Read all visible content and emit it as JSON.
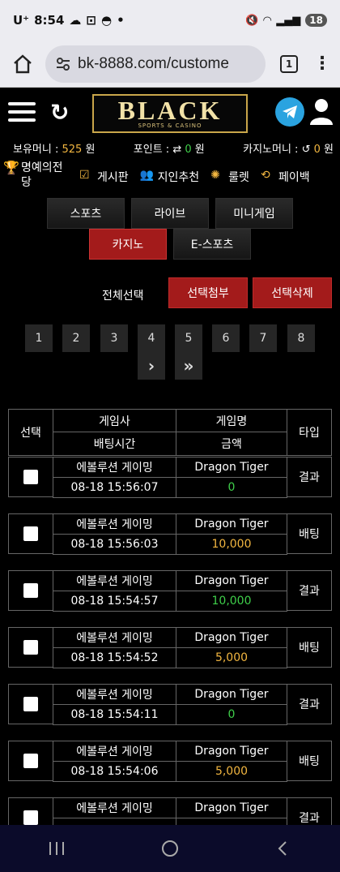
{
  "status": {
    "carrier": "U⁺",
    "time": "8:54",
    "battery": "18"
  },
  "browser": {
    "url": "bk-8888.com/custome",
    "tab_count": "1"
  },
  "header": {
    "logo_brand": "BLACK",
    "logo_sub": "SPORTS & CASINO"
  },
  "balance": {
    "money_label": "보유머니 :",
    "money_value": "525",
    "money_unit": "원",
    "point_label": "포인트 :",
    "point_value": "0",
    "point_unit": "원",
    "casino_label": "카지노머니 :",
    "casino_value": "0",
    "casino_unit": "원"
  },
  "nav": {
    "hall_of_fame": "명예의전당",
    "board": "게시판",
    "referral": "지인추천",
    "roulette": "룰렛",
    "payback": "페이백"
  },
  "tabs": [
    "스포츠",
    "라이브",
    "미니게임",
    "카지노",
    "E-스포츠"
  ],
  "active_tab": "카지노",
  "actions": {
    "select_all": "전체선택",
    "attach": "선택첨부",
    "delete": "선택삭제"
  },
  "pager": {
    "pages": [
      "1",
      "2",
      "3",
      "4",
      "5",
      "6",
      "7",
      "8"
    ],
    "next": "›",
    "last": "»"
  },
  "table": {
    "headers": {
      "select": "선택",
      "provider": "게임사",
      "game": "게임명",
      "type": "타입",
      "bet_time": "배팅시간",
      "amount": "금액"
    },
    "rows": [
      {
        "provider": "에볼루션 게이밍",
        "game": "Dragon Tiger",
        "time": "08-18 15:56:07",
        "amount": "0",
        "type": "결과"
      },
      {
        "provider": "에볼루션 게이밍",
        "game": "Dragon Tiger",
        "time": "08-18 15:56:03",
        "amount": "10,000",
        "type": "배팅"
      },
      {
        "provider": "에볼루션 게이밍",
        "game": "Dragon Tiger",
        "time": "08-18 15:54:57",
        "amount": "10,000",
        "type": "결과"
      },
      {
        "provider": "에볼루션 게이밍",
        "game": "Dragon Tiger",
        "time": "08-18 15:54:52",
        "amount": "5,000",
        "type": "배팅"
      },
      {
        "provider": "에볼루션 게이밍",
        "game": "Dragon Tiger",
        "time": "08-18 15:54:11",
        "amount": "0",
        "type": "결과"
      },
      {
        "provider": "에볼루션 게이밍",
        "game": "Dragon Tiger",
        "time": "08-18 15:54:06",
        "amount": "5,000",
        "type": "배팅"
      },
      {
        "provider": "에볼루션 게이밍",
        "game": "Dragon Tiger",
        "time": "",
        "amount": "",
        "type": "결과"
      }
    ]
  },
  "colors": {
    "accent_red": "#a31b1b",
    "gold": "#f2b640",
    "green": "#3fcf4a",
    "telegram": "#2aa3e0"
  }
}
